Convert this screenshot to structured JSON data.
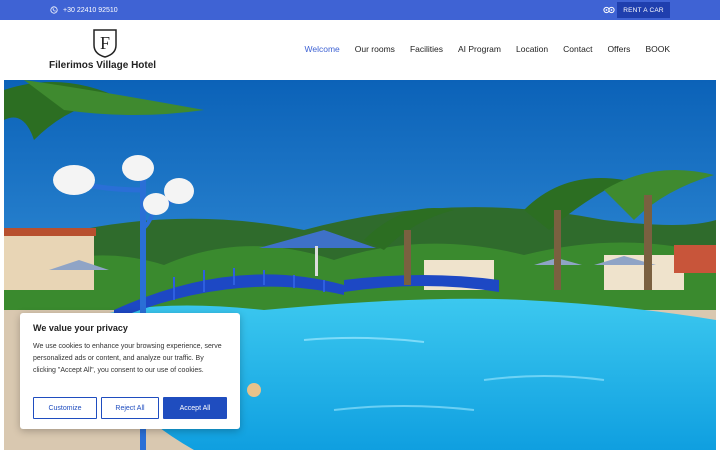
{
  "topbar": {
    "phone": "+30 22410 92510",
    "rent_label": "RENT A CAR"
  },
  "header": {
    "logo_letter": "F",
    "hotel_name": "Filerimos Village Hotel"
  },
  "nav": {
    "items": [
      "Welcome",
      "Our rooms",
      "Facilities",
      "AI Program",
      "Location",
      "Contact",
      "Offers",
      "BOOK"
    ],
    "active": "Welcome"
  },
  "cookie": {
    "title": "We value your privacy",
    "text": "We use cookies to enhance your browsing experience, serve personalized ads or content, and analyze our traffic. By clicking \"Accept All\", you consent to our use of cookies.",
    "customize": "Customize",
    "reject": "Reject All",
    "accept": "Accept All"
  },
  "colors": {
    "brand": "#3f63d4",
    "button_blue": "#1f4dbf",
    "pool": "#29b7e6",
    "sky": "#0b74c8"
  },
  "icons": [
    "phone-icon",
    "tripadvisor-icon"
  ]
}
